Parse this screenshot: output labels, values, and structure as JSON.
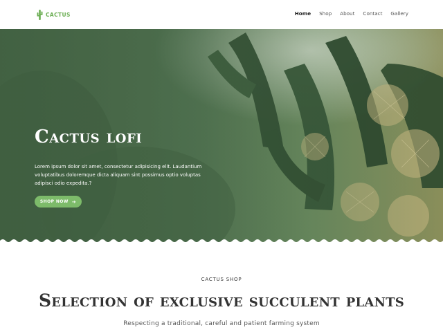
{
  "brand": {
    "name": "CACTUS",
    "color": "#6cae54",
    "icon": "cactus-icon"
  },
  "nav": {
    "items": [
      {
        "label": "Home",
        "active": true
      },
      {
        "label": "Shop",
        "active": false
      },
      {
        "label": "About",
        "active": false
      },
      {
        "label": "Contact",
        "active": false
      },
      {
        "label": "Gallery",
        "active": false
      }
    ]
  },
  "hero": {
    "title": "Cactus lofi",
    "text": "Lorem ipsum dolor sit amet, consectetur adipisicing elit. Laudantium voluptatibus doloremque dicta aliquam sint possimus optio voluptas adipisci odio expedita.?",
    "button_label": "SHOP NOW",
    "button_icon": "arrow-right-icon",
    "button_color": "#7dbb6a"
  },
  "section": {
    "kicker": "CACTUS SHOP",
    "title": "Selection of exclusive succulent plants",
    "subtitle": "Respecting a traditional, careful and patient farming system"
  }
}
